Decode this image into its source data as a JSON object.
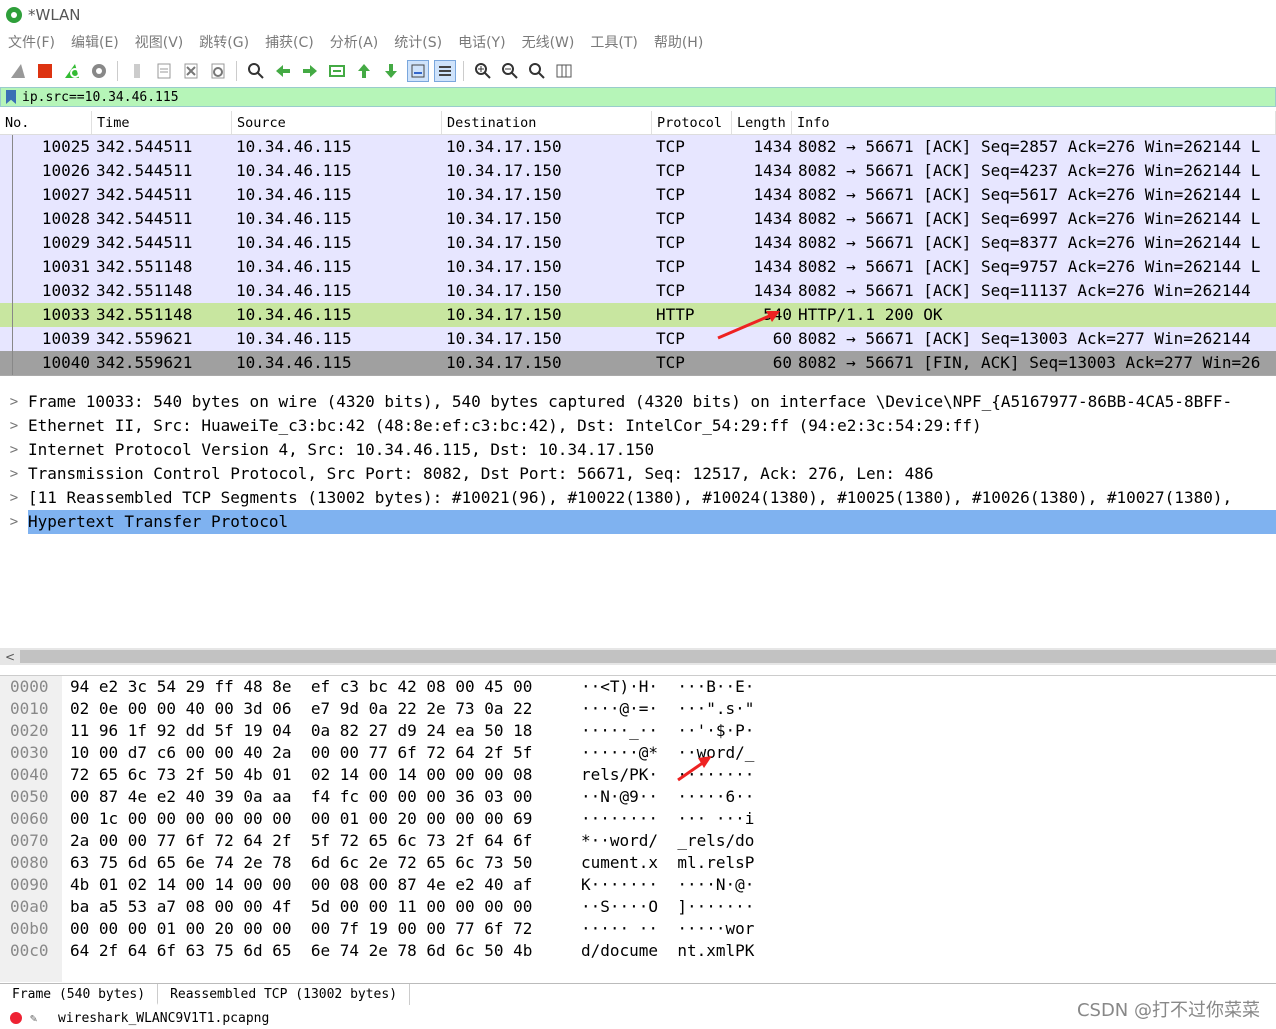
{
  "window": {
    "title": "*WLAN"
  },
  "menu": [
    "文件(F)",
    "编辑(E)",
    "视图(V)",
    "跳转(G)",
    "捕获(C)",
    "分析(A)",
    "统计(S)",
    "电话(Y)",
    "无线(W)",
    "工具(T)",
    "帮助(H)"
  ],
  "filter": {
    "value": "ip.src==10.34.46.115"
  },
  "columns": {
    "no": "No.",
    "time": "Time",
    "source": "Source",
    "destination": "Destination",
    "protocol": "Protocol",
    "length": "Length",
    "info": "Info"
  },
  "packets": [
    {
      "no": "10025",
      "time": "342.544511",
      "src": "10.34.46.115",
      "dst": "10.34.17.150",
      "proto": "TCP",
      "len": "1434",
      "info": "8082 → 56671 [ACK] Seq=2857 Ack=276 Win=262144 L"
    },
    {
      "no": "10026",
      "time": "342.544511",
      "src": "10.34.46.115",
      "dst": "10.34.17.150",
      "proto": "TCP",
      "len": "1434",
      "info": "8082 → 56671 [ACK] Seq=4237 Ack=276 Win=262144 L"
    },
    {
      "no": "10027",
      "time": "342.544511",
      "src": "10.34.46.115",
      "dst": "10.34.17.150",
      "proto": "TCP",
      "len": "1434",
      "info": "8082 → 56671 [ACK] Seq=5617 Ack=276 Win=262144 L"
    },
    {
      "no": "10028",
      "time": "342.544511",
      "src": "10.34.46.115",
      "dst": "10.34.17.150",
      "proto": "TCP",
      "len": "1434",
      "info": "8082 → 56671 [ACK] Seq=6997 Ack=276 Win=262144 L"
    },
    {
      "no": "10029",
      "time": "342.544511",
      "src": "10.34.46.115",
      "dst": "10.34.17.150",
      "proto": "TCP",
      "len": "1434",
      "info": "8082 → 56671 [ACK] Seq=8377 Ack=276 Win=262144 L"
    },
    {
      "no": "10031",
      "time": "342.551148",
      "src": "10.34.46.115",
      "dst": "10.34.17.150",
      "proto": "TCP",
      "len": "1434",
      "info": "8082 → 56671 [ACK] Seq=9757 Ack=276 Win=262144 L"
    },
    {
      "no": "10032",
      "time": "342.551148",
      "src": "10.34.46.115",
      "dst": "10.34.17.150",
      "proto": "TCP",
      "len": "1434",
      "info": "8082 → 56671 [ACK] Seq=11137 Ack=276 Win=262144"
    },
    {
      "no": "10033",
      "time": "342.551148",
      "src": "10.34.46.115",
      "dst": "10.34.17.150",
      "proto": "HTTP",
      "len": "540",
      "info": "HTTP/1.1 200 OK"
    },
    {
      "no": "10039",
      "time": "342.559621",
      "src": "10.34.46.115",
      "dst": "10.34.17.150",
      "proto": "TCP",
      "len": "60",
      "info": "8082 → 56671 [ACK] Seq=13003 Ack=277 Win=262144"
    },
    {
      "no": "10040",
      "time": "342.559621",
      "src": "10.34.46.115",
      "dst": "10.34.17.150",
      "proto": "TCP",
      "len": "60",
      "info": "8082 → 56671 [FIN, ACK] Seq=13003 Ack=277 Win=26"
    }
  ],
  "details": [
    "Frame 10033: 540 bytes on wire (4320 bits), 540 bytes captured (4320 bits) on interface \\Device\\NPF_{A5167977-86BB-4CA5-8BFF-",
    "Ethernet II, Src: HuaweiTe_c3:bc:42 (48:8e:ef:c3:bc:42), Dst: IntelCor_54:29:ff (94:e2:3c:54:29:ff)",
    "Internet Protocol Version 4, Src: 10.34.46.115, Dst: 10.34.17.150",
    "Transmission Control Protocol, Src Port: 8082, Dst Port: 56671, Seq: 12517, Ack: 276, Len: 486",
    "[11 Reassembled TCP Segments (13002 bytes): #10021(96), #10022(1380), #10024(1380), #10025(1380), #10026(1380), #10027(1380),",
    "Hypertext Transfer Protocol"
  ],
  "hex": [
    {
      "off": "0000",
      "hex": "94 e2 3c 54 29 ff 48 8e  ef c3 bc 42 08 00 45 00",
      "asc": "··<T)·H·  ···B··E·"
    },
    {
      "off": "0010",
      "hex": "02 0e 00 00 40 00 3d 06  e7 9d 0a 22 2e 73 0a 22",
      "asc": "····@·=·  ···\".s·\""
    },
    {
      "off": "0020",
      "hex": "11 96 1f 92 dd 5f 19 04  0a 82 27 d9 24 ea 50 18",
      "asc": "·····_··  ··'·$·P·"
    },
    {
      "off": "0030",
      "hex": "10 00 d7 c6 00 00 40 2a  00 00 77 6f 72 64 2f 5f",
      "asc": "······@*  ··word/_"
    },
    {
      "off": "0040",
      "hex": "72 65 6c 73 2f 50 4b 01  02 14 00 14 00 00 00 08",
      "asc": "rels/PK·  ········"
    },
    {
      "off": "0050",
      "hex": "00 87 4e e2 40 39 0a aa  f4 fc 00 00 00 36 03 00",
      "asc": "··N·@9··  ·····6··"
    },
    {
      "off": "0060",
      "hex": "00 1c 00 00 00 00 00 00  00 01 00 20 00 00 00 69",
      "asc": "········  ··· ···i"
    },
    {
      "off": "0070",
      "hex": "2a 00 00 77 6f 72 64 2f  5f 72 65 6c 73 2f 64 6f",
      "asc": "*··word/  _rels/do"
    },
    {
      "off": "0080",
      "hex": "63 75 6d 65 6e 74 2e 78  6d 6c 2e 72 65 6c 73 50",
      "asc": "cument.x  ml.relsP"
    },
    {
      "off": "0090",
      "hex": "4b 01 02 14 00 14 00 00  00 08 00 87 4e e2 40 af",
      "asc": "K·······  ····N·@·"
    },
    {
      "off": "00a0",
      "hex": "ba a5 53 a7 08 00 00 4f  5d 00 00 11 00 00 00 00",
      "asc": "··S····O  ]·······"
    },
    {
      "off": "00b0",
      "hex": "00 00 00 01 00 20 00 00  00 7f 19 00 00 77 6f 72",
      "asc": "····· ··  ·····wor"
    },
    {
      "off": "00c0",
      "hex": "64 2f 64 6f 63 75 6d 65  6e 74 2e 78 6d 6c 50 4b",
      "asc": "d/docume  nt.xmlPK"
    }
  ],
  "tabs": [
    "Frame (540 bytes)",
    "Reassembled TCP (13002 bytes)"
  ],
  "status": {
    "file": "wireshark_WLANC9V1T1.pcapng"
  },
  "watermark": "CSDN @打不过你菜菜",
  "colors": {
    "tcp_row": "#e7e6ff",
    "http_row": "#c8e6a0",
    "selected_detail": "#7fb2f0",
    "filter_ok": "#b6f5b8"
  }
}
